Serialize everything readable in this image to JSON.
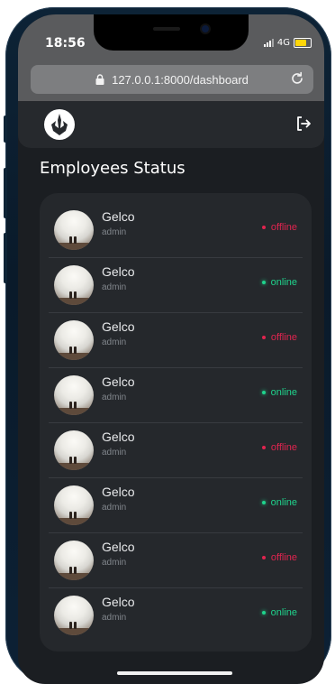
{
  "status_bar": {
    "time": "18:56",
    "network": "4G"
  },
  "browser": {
    "url": "127.0.0.1:8000/dashboard"
  },
  "page": {
    "title": "Employees Status"
  },
  "employees": [
    {
      "name": "Gelco",
      "role": "admin",
      "status": "offline"
    },
    {
      "name": "Gelco",
      "role": "admin",
      "status": "online"
    },
    {
      "name": "Gelco",
      "role": "admin",
      "status": "offline"
    },
    {
      "name": "Gelco",
      "role": "admin",
      "status": "online"
    },
    {
      "name": "Gelco",
      "role": "admin",
      "status": "offline"
    },
    {
      "name": "Gelco",
      "role": "admin",
      "status": "online"
    },
    {
      "name": "Gelco",
      "role": "admin",
      "status": "offline"
    },
    {
      "name": "Gelco",
      "role": "admin",
      "status": "online"
    }
  ],
  "icons": {
    "logo": "rebel-alliance-icon",
    "logout": "sign-out-icon",
    "lock": "lock-icon",
    "reload": "reload-icon"
  },
  "colors": {
    "offline": "#e0244f",
    "online": "#1fd48d",
    "card": "#25282c",
    "background": "#1b1e22"
  }
}
